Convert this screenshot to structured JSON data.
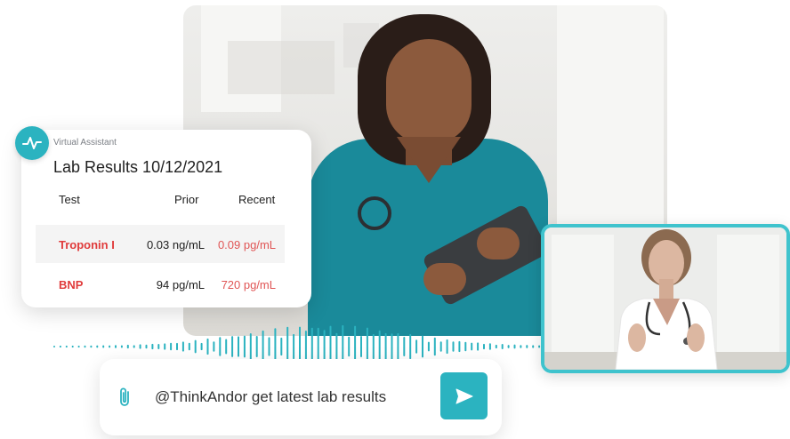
{
  "assistant": {
    "label": "Virtual Assistant",
    "icon": "activity-pulse-icon",
    "accent_color": "#2bb3c0"
  },
  "lab_results": {
    "title": "Lab Results 10/12/2021",
    "columns": [
      "Test",
      "Prior",
      "Recent"
    ],
    "rows": [
      {
        "test": "Troponin I",
        "prior": "0.03 ng/mL",
        "recent": "0.09 pg/mL"
      },
      {
        "test": "BNP",
        "prior": "94 pg/mL",
        "recent": "720 pg/mL"
      }
    ],
    "alert_color": "#e03b3b"
  },
  "message_input": {
    "value": "@ThinkAndor get latest lab results",
    "attach_icon": "paperclip-icon",
    "send_icon": "send-arrow-icon"
  },
  "video_call": {
    "border_color": "#3fc3cd"
  }
}
